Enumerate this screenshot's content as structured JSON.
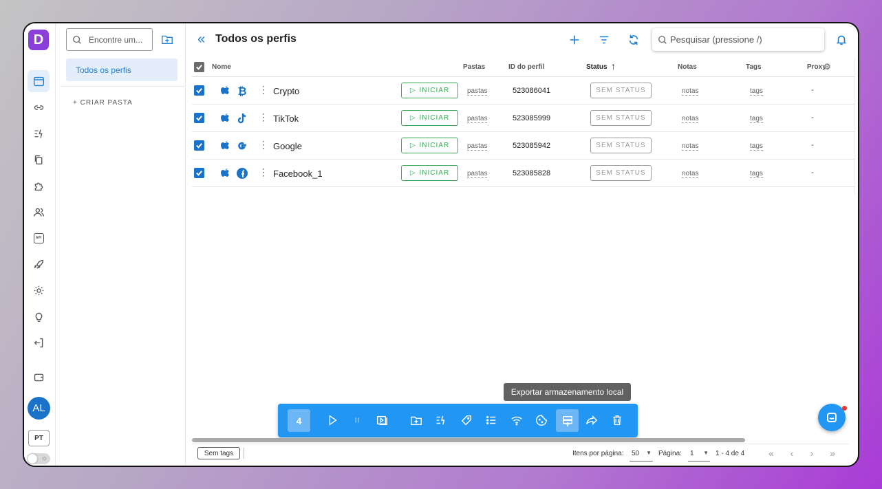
{
  "app": {
    "logo_letter": "D",
    "brand_color": "#8b3fd9",
    "accent": "#1a7fd6"
  },
  "rail": {
    "items": [
      {
        "icon": "browser-window-icon",
        "active": true
      },
      {
        "icon": "link-icon"
      },
      {
        "icon": "automation-icon"
      },
      {
        "icon": "copy-icon"
      },
      {
        "icon": "puzzle-icon"
      },
      {
        "icon": "users-icon"
      },
      {
        "icon": "api-icon"
      },
      {
        "icon": "rocket-icon"
      },
      {
        "icon": "gear-icon"
      },
      {
        "icon": "lightbulb-icon"
      },
      {
        "icon": "logout-icon"
      },
      {
        "icon": "wallet-icon"
      }
    ],
    "api_label": "API",
    "avatar_initials": "AL",
    "language": "PT"
  },
  "folders": {
    "search_placeholder": "Encontre um...",
    "active_folder": "Todos os perfis",
    "create_label": "+ CRIAR PASTA"
  },
  "header": {
    "title": "Todos os perfis",
    "search_placeholder": "Pesquisar (pressione /)"
  },
  "table": {
    "columns": {
      "name": "Nome",
      "folders": "Pastas",
      "profile_id": "ID do perfil",
      "status": "Status",
      "notes": "Notas",
      "tags": "Tags",
      "proxy": "Proxy"
    },
    "rows": [
      {
        "name": "Crypto",
        "brand_icon": "bitcoin-icon",
        "start": "INICIAR",
        "folders": "pastas",
        "id": "523086041",
        "status": "SEM STATUS",
        "notes": "notas",
        "tags": "tags",
        "proxy": "-"
      },
      {
        "name": "TikTok",
        "brand_icon": "tiktok-icon",
        "start": "INICIAR",
        "folders": "pastas",
        "id": "523085999",
        "status": "SEM STATUS",
        "notes": "notas",
        "tags": "tags",
        "proxy": "-"
      },
      {
        "name": "Google",
        "brand_icon": "google-icon",
        "start": "INICIAR",
        "folders": "pastas",
        "id": "523085942",
        "status": "SEM STATUS",
        "notes": "notas",
        "tags": "tags",
        "proxy": "-"
      },
      {
        "name": "Facebook_1",
        "brand_icon": "facebook-icon",
        "start": "INICIAR",
        "folders": "pastas",
        "id": "523085828",
        "status": "SEM STATUS",
        "notes": "notas",
        "tags": "tags",
        "proxy": "-"
      }
    ]
  },
  "bulk_bar": {
    "selected_count": "4",
    "tooltip": "Exportar armazenamento local"
  },
  "footer": {
    "no_tags": "Sem tags",
    "items_per_page_label": "Itens por página:",
    "items_per_page": "50",
    "page_label": "Página:",
    "page": "1",
    "range": "1 - 4 de 4"
  }
}
